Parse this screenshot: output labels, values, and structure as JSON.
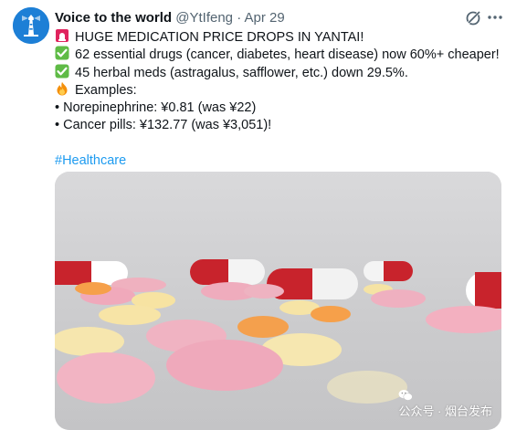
{
  "tweet": {
    "author": {
      "display_name": "Voice to the world",
      "handle": "@YtIfeng",
      "separator": "·",
      "date": "Apr 29",
      "avatar_icon": "lighthouse-icon"
    },
    "lines": [
      {
        "icon": "rotating-light-icon",
        "text": "HUGE MEDICATION PRICE DROPS IN YANTAI!"
      },
      {
        "icon": "check-mark-button-icon",
        "text": "62 essential drugs (cancer, diabetes, heart disease) now 60%+ cheaper!"
      },
      {
        "icon": "check-mark-button-icon",
        "text": "45 herbal meds (astragalus, safflower, etc.) down 29.5%."
      },
      {
        "icon": "fire-icon",
        "text": "Examples:"
      },
      {
        "icon": "",
        "text": "• Norepinephrine: ¥0.81 (was ¥22)"
      },
      {
        "icon": "",
        "text": "• Cancer pills: ¥132.77 (was ¥3,051)!"
      }
    ],
    "hashtag": "#Healthcare",
    "media": {
      "alt_icon": "pills-photo",
      "watermark": "公众号 · 烟台发布",
      "watermark_icon": "wechat-icon"
    },
    "actions": {
      "grok_icon": "grok-icon",
      "more_icon": "more-options-icon"
    }
  },
  "colors": {
    "text": "#0f1419",
    "meta": "#536471",
    "link": "#1d9bf0",
    "check_green": "#5fbb46",
    "alert_red": "#e0245e",
    "avatar_blue": "#1d7fd6"
  }
}
